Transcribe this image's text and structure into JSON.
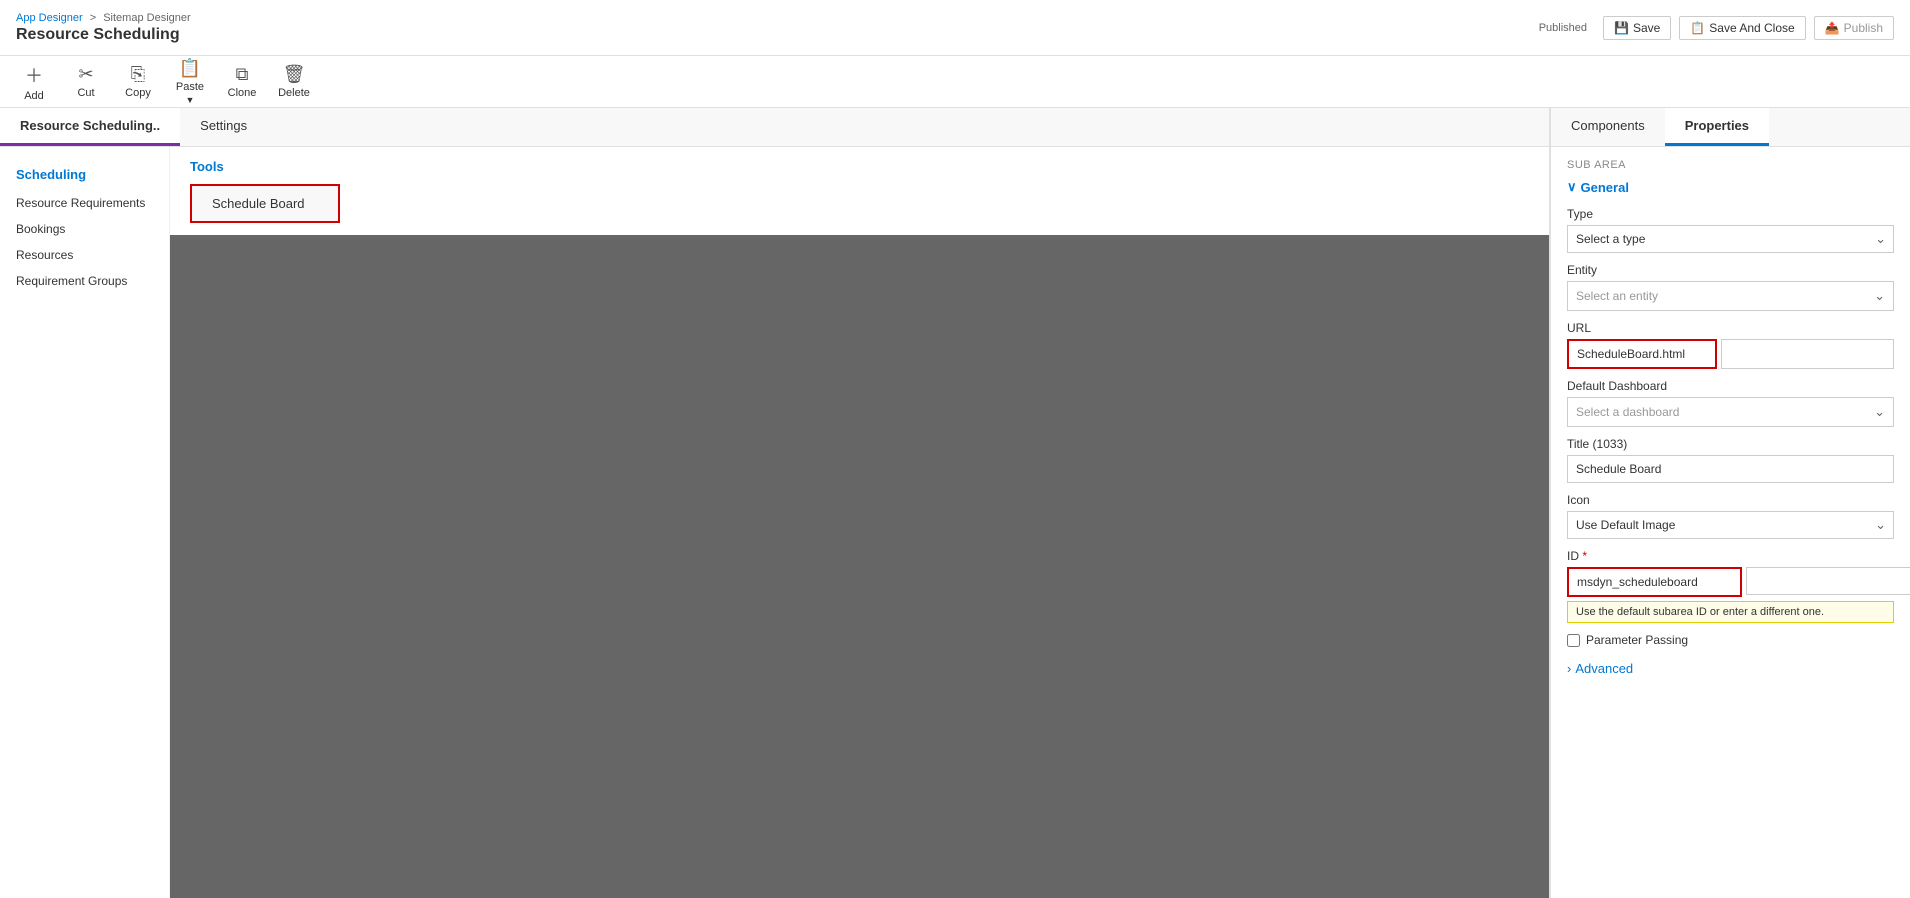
{
  "header": {
    "breadcrumb": {
      "app": "App Designer",
      "sep": ">",
      "page": "Sitemap Designer"
    },
    "app_title": "Resource Scheduling",
    "published_label": "Published",
    "save_label": "Save",
    "save_close_label": "Save And Close",
    "publish_label": "Publish"
  },
  "toolbar": {
    "add_label": "Add",
    "cut_label": "Cut",
    "copy_label": "Copy",
    "paste_label": "Paste",
    "clone_label": "Clone",
    "delete_label": "Delete"
  },
  "tabs": {
    "main_tab": "Resource Scheduling..",
    "settings_tab": "Settings"
  },
  "sidebar": {
    "group_label": "Scheduling",
    "items": [
      {
        "label": "Resource Requirements"
      },
      {
        "label": "Bookings"
      },
      {
        "label": "Resources"
      },
      {
        "label": "Requirement Groups"
      }
    ]
  },
  "tools": {
    "label": "Tools",
    "schedule_board_label": "Schedule Board"
  },
  "right_panel": {
    "components_tab": "Components",
    "properties_tab": "Properties",
    "sub_area_label": "SUB AREA",
    "general_section": "General",
    "type_label": "Type",
    "type_placeholder": "Select a type",
    "entity_label": "Entity",
    "entity_placeholder": "Select an entity",
    "url_label": "URL",
    "url_value": "ScheduleBoard.html",
    "url_extra_placeholder": "",
    "default_dashboard_label": "Default Dashboard",
    "dashboard_placeholder": "Select a dashboard",
    "title_label": "Title (1033)",
    "title_value": "Schedule Board",
    "icon_label": "Icon",
    "icon_value": "Use Default Image",
    "id_label": "ID",
    "id_value": "msdyn_scheduleboard",
    "id_second_value": "",
    "id_tooltip": "Use the default subarea ID or enter a different one.",
    "parameter_passing_label": "Parameter Passing",
    "advanced_label": "Advanced"
  }
}
